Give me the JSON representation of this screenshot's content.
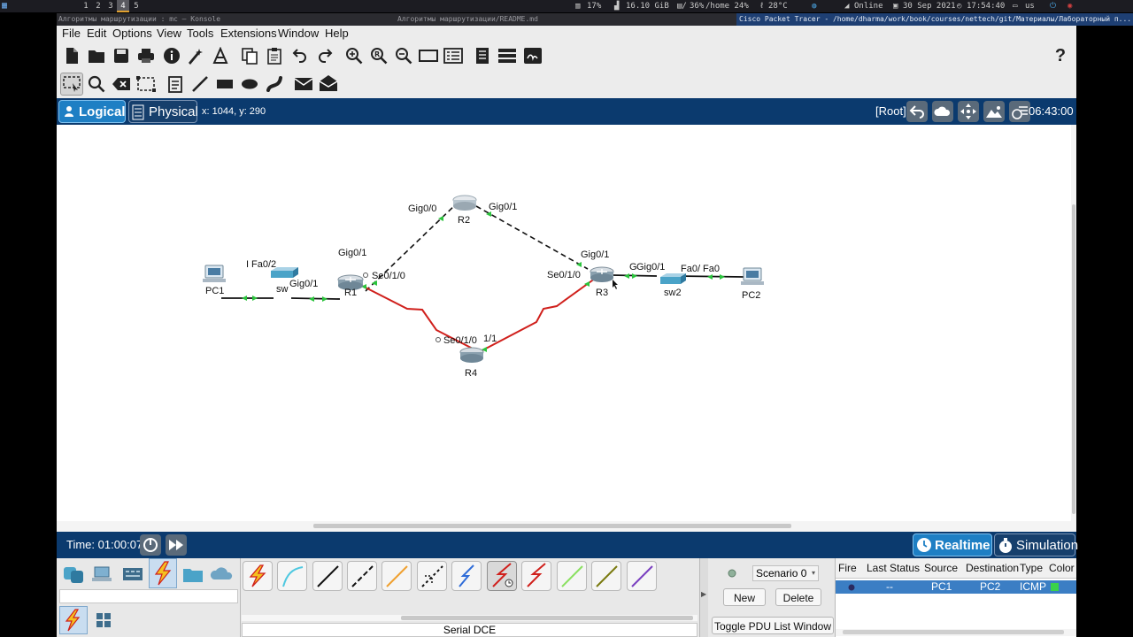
{
  "system_panel": {
    "workspaces": [
      "1",
      "2",
      "3",
      "4",
      "5"
    ],
    "active_workspace": "4",
    "cpu": "17%",
    "memory": "16.10 GiB",
    "disk_root": "36%",
    "disk_home": "/home 24%",
    "temperature": "28°C",
    "network": "Online",
    "date": "30 Sep 2021",
    "clock": "17:54:40",
    "keyboard_layout": "us"
  },
  "window_titles": [
    "Алгоритмы маршрутизации : mc — Konsole",
    "Алгоритмы маршрутизации/README.md",
    "Cisco Packet Tracer - /home/dharma/work/book/courses/nettech/git/Материалы/Лабораторный п..."
  ],
  "menu": [
    "File",
    "Edit",
    "Options",
    "View",
    "Tools",
    "Extensions",
    "Window",
    "Help"
  ],
  "toolbar1_icons": [
    "new-icon",
    "open-icon",
    "save-icon",
    "print-icon",
    "info-icon",
    "wizard-icon",
    "copy-icon",
    "paste-icon",
    "undo-icon",
    "redo-icon",
    "zoom-in-icon",
    "zoom-reset-icon",
    "zoom-out-icon",
    "rectangle-view-icon",
    "palette-icon",
    "custom-device-icon",
    "cluster-icon",
    "network-controller-icon"
  ],
  "help_label": "?",
  "toolbar2_icons": [
    "select-icon",
    "inspect-icon",
    "delete-icon",
    "resize-icon",
    "note-icon",
    "line-icon",
    "rect-icon",
    "ellipse-icon",
    "freeform-icon",
    "simple-pdu-icon",
    "complex-pdu-icon"
  ],
  "modebar": {
    "logical": "Logical",
    "physical": "Physical",
    "coords": "x: 1044, y: 290",
    "root": "[Root]",
    "time": "06:43:00"
  },
  "topology": {
    "devices": {
      "pc1": "PC1",
      "sw1": "sw",
      "r1": "R1",
      "r2": "R2",
      "r3": "R3",
      "r4": "R4",
      "sw2": "sw2",
      "pc2": "PC2"
    },
    "ports": {
      "pc1_fa": "Fa0/2",
      "sw1_gig": "Gig0/1",
      "r1_gig01": "Gig0/1",
      "r1_se010": "Se0/1/0",
      "r2_gig00": "Gig0/0",
      "r2_gig01": "Gig0/1",
      "r3_gig01": "Gig0/1",
      "r3_se010": "Se0/1/0",
      "r3_g": "G",
      "sw2_gig01": "Gig0/1",
      "sw2_fa0": "Fa0/",
      "pc2_fa0": "Fa0",
      "r4_se010": "Se0/1/0",
      "r4_11": "1/1"
    }
  },
  "timebar": {
    "time": "Time: 01:00:07",
    "realtime": "Realtime",
    "simulation": "Simulation"
  },
  "bottom": {
    "device_categories": [
      "network-devices-icon",
      "end-devices-icon",
      "components-icon",
      "connections-icon",
      "misc-icon",
      "multiuser-icon"
    ],
    "connection_types": [
      "auto",
      "console",
      "straight",
      "crossover",
      "fiber",
      "phone",
      "coaxial",
      "serial-dce",
      "serial-dte",
      "octal",
      "iot",
      "usb"
    ],
    "selected_connection_label": "Serial DCE",
    "scenario": "Scenario 0",
    "new_button": "New",
    "delete_button": "Delete",
    "toggle_button": "Toggle PDU List Window",
    "pdu_table": {
      "headers": [
        "Fire",
        "Last Status",
        "Source",
        "Destination",
        "Type",
        "Color"
      ],
      "rows": [
        {
          "last_status": "--",
          "source": "PC1",
          "destination": "PC2",
          "type": "ICMP",
          "color": "#3ad24a"
        }
      ]
    }
  },
  "colors": {
    "accent_blue": "#0b3a6e",
    "serial_link": "#d0201c",
    "link_up": "#2bc43d",
    "active_tab": "#1e7fc4"
  }
}
